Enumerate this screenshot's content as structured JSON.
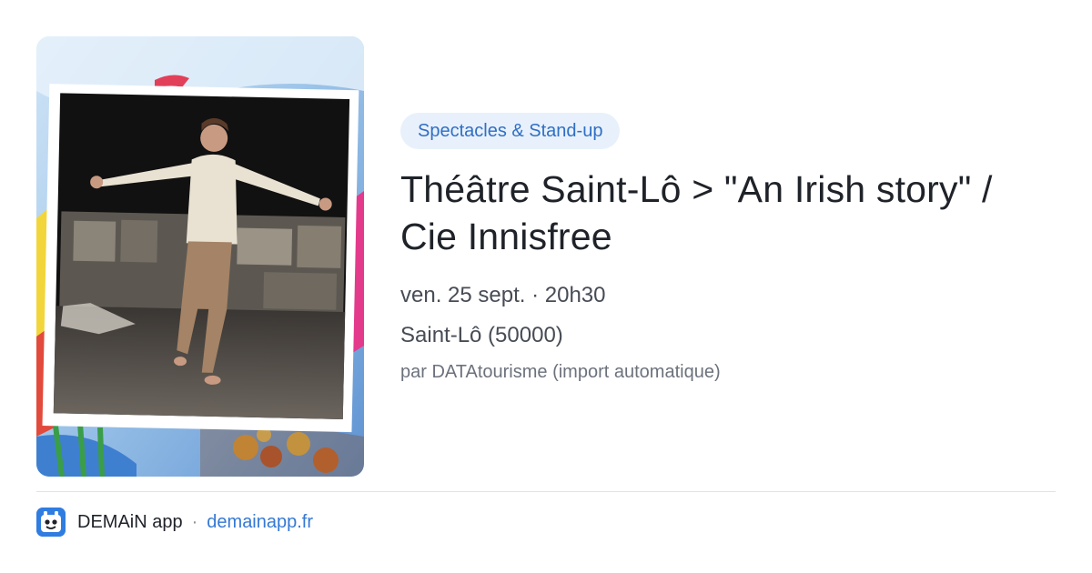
{
  "event": {
    "category": "Spectacles & Stand-up",
    "title": "Théâtre Saint-Lô > \"An Irish story\" / Cie Innisfree",
    "date": "ven. 25 sept. · 20h30",
    "place": "Saint-Lô (50000)",
    "source": "par DATAtourisme (import automatique)",
    "image_icon": "event-photo"
  },
  "footer": {
    "app_name": "DEMAiN app",
    "separator": "·",
    "url": "demainapp.fr",
    "logo_icon": "demain-app-logo-icon"
  },
  "colors": {
    "chip_bg": "#e8f1fb",
    "chip_text": "#2f6fc4",
    "link": "#3579d4",
    "logo": "#2f7de1"
  }
}
